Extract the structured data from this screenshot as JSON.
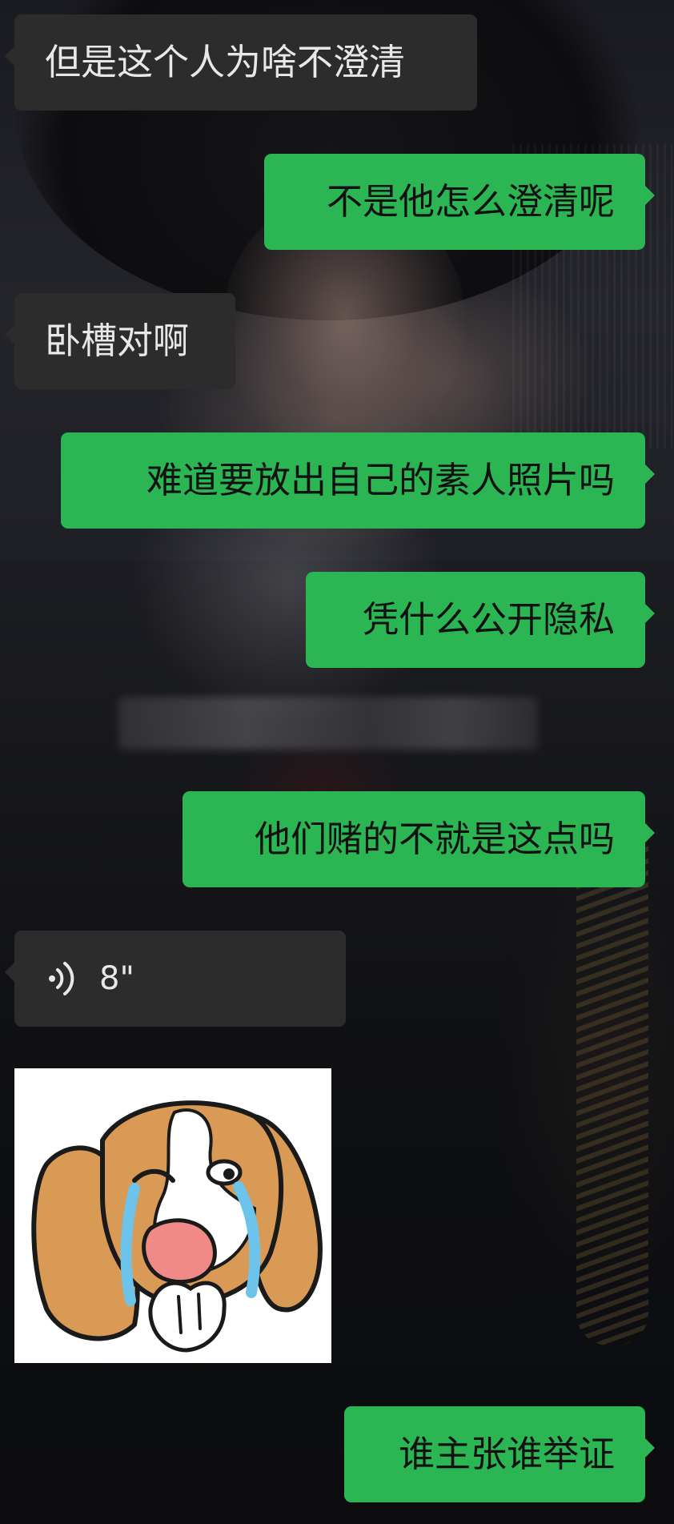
{
  "chat": {
    "messages": [
      {
        "side": "received",
        "text": "但是这个人为啥不澄清"
      },
      {
        "side": "sent",
        "text": "不是他怎么澄清呢"
      },
      {
        "side": "received",
        "text": "卧槽对啊"
      },
      {
        "side": "sent",
        "text": "难道要放出自己的素人照片吗"
      },
      {
        "side": "sent",
        "text": "凭什么公开隐私"
      },
      {
        "side": "sent",
        "text": "他们赌的不就是这点吗"
      },
      {
        "side": "received",
        "type": "voice",
        "duration": "8\""
      },
      {
        "side": "received",
        "type": "sticker",
        "icon": "crying-dog-sticker"
      },
      {
        "side": "sent",
        "text": "谁主张谁举证"
      }
    ]
  },
  "colors": {
    "sent_bubble": "#2bb553",
    "received_bubble": "#2c2c2c",
    "received_text": "#e8e8e8",
    "sent_text": "#111111"
  }
}
